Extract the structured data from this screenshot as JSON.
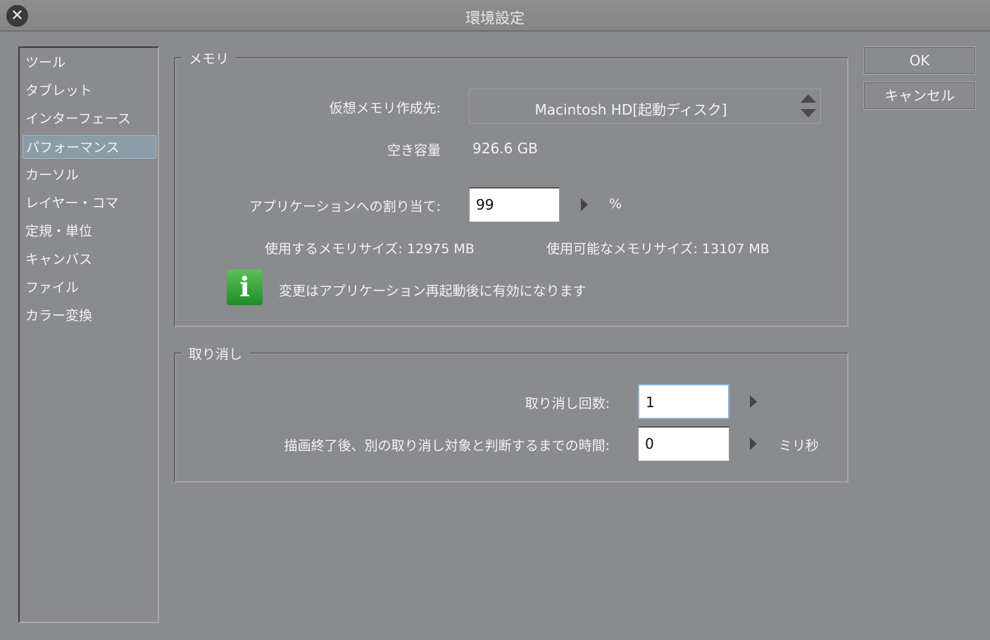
{
  "window": {
    "title": "環境設定"
  },
  "sidebar": {
    "items": [
      {
        "label": "ツール"
      },
      {
        "label": "タブレット"
      },
      {
        "label": "インターフェース"
      },
      {
        "label": "パフォーマンス",
        "selected": true
      },
      {
        "label": "カーソル"
      },
      {
        "label": "レイヤー・コマ"
      },
      {
        "label": "定規・単位"
      },
      {
        "label": "キャンバス"
      },
      {
        "label": "ファイル"
      },
      {
        "label": "カラー変換"
      }
    ]
  },
  "memory": {
    "legend": "メモリ",
    "vm_label": "仮想メモリ作成先:",
    "vm_value": "Macintosh HD[起動ディスク]",
    "free_label": "空き容量",
    "free_value": "926.6 GB",
    "alloc_label": "アプリケーションへの割り当て:",
    "alloc_value": "99",
    "alloc_unit": "%",
    "used_label": "使用するメモリサイズ:",
    "used_value": "12975 MB",
    "avail_label": "使用可能なメモリサイズ:",
    "avail_value": "13107 MB",
    "info_text": "変更はアプリケーション再起動後に有効になります"
  },
  "undo": {
    "legend": "取り消し",
    "count_label": "取り消し回数:",
    "count_value": "1",
    "time_label": "描画終了後、別の取り消し対象と判断するまでの時間:",
    "time_value": "0",
    "time_unit": "ミリ秒"
  },
  "buttons": {
    "ok": "OK",
    "cancel": "キャンセル"
  }
}
